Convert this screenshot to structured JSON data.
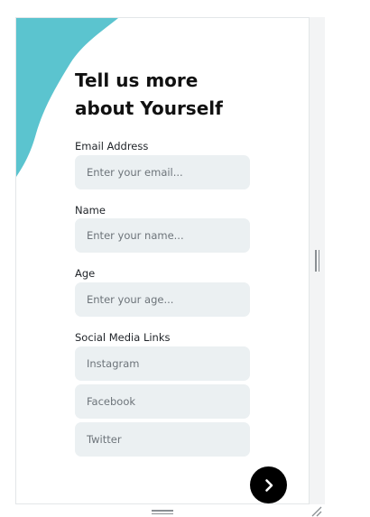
{
  "form": {
    "title_line1": "Tell us more",
    "title_line2": "about Yourself",
    "email_label": "Email Address",
    "email_placeholder": "Enter your email...",
    "name_label": "Name",
    "name_placeholder": "Enter your name...",
    "age_label": "Age",
    "age_placeholder": "Enter your age...",
    "social_label": "Social Media Links",
    "instagram_placeholder": "Instagram",
    "facebook_placeholder": "Facebook",
    "twitter_placeholder": "Twitter"
  },
  "icons": {
    "next": "chevron-right-icon",
    "side_resize": "vertical-resize-handle-icon",
    "bottom_resize": "horizontal-resize-handle-icon",
    "corner_resize": "resize-grip-icon"
  },
  "colors": {
    "accent_blob": "#5bc4cf",
    "input_background": "#ebf0f2",
    "button_background": "#000000"
  }
}
